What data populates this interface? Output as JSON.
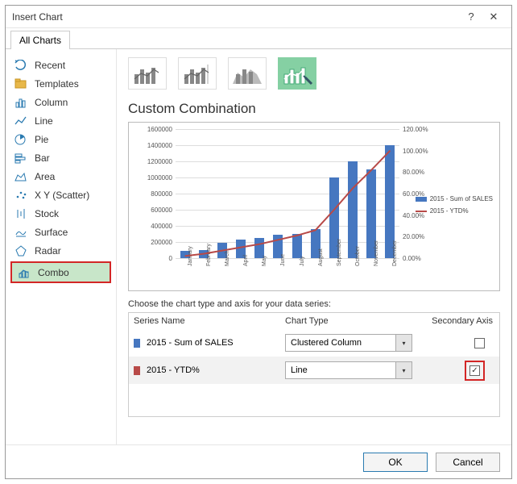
{
  "dialog": {
    "title": "Insert Chart"
  },
  "tabs": {
    "all_charts": "All Charts"
  },
  "sidebar": {
    "items": [
      {
        "label": "Recent"
      },
      {
        "label": "Templates"
      },
      {
        "label": "Column"
      },
      {
        "label": "Line"
      },
      {
        "label": "Pie"
      },
      {
        "label": "Bar"
      },
      {
        "label": "Area"
      },
      {
        "label": "X Y (Scatter)"
      },
      {
        "label": "Stock"
      },
      {
        "label": "Surface"
      },
      {
        "label": "Radar"
      },
      {
        "label": "Combo"
      }
    ]
  },
  "section": {
    "title": "Custom Combination"
  },
  "series_caption": "Choose the chart type and axis for your data series:",
  "series_table": {
    "headers": {
      "name": "Series Name",
      "type": "Chart Type",
      "axis": "Secondary Axis"
    },
    "rows": [
      {
        "color": "#4677c0",
        "name": "2015 - Sum of SALES",
        "type": "Clustered Column",
        "secondary": false
      },
      {
        "color": "#b84a48",
        "name": "2015 - YTD%",
        "type": "Line",
        "secondary": true
      }
    ]
  },
  "legend": {
    "s1": "2015 - Sum of SALES",
    "s2": "2015 - YTD%"
  },
  "buttons": {
    "ok": "OK",
    "cancel": "Cancel"
  },
  "chart_data": {
    "type": "combo",
    "title": "",
    "categories": [
      "January",
      "February",
      "March",
      "April",
      "May",
      "June",
      "July",
      "August",
      "September",
      "October",
      "November",
      "December"
    ],
    "y1": {
      "label": "",
      "min": 0,
      "max": 1600000,
      "ticks": [
        0,
        200000,
        400000,
        600000,
        800000,
        1000000,
        1200000,
        1400000,
        1600000
      ]
    },
    "y2": {
      "label": "",
      "min": 0,
      "max": 120,
      "ticks": [
        "0.00%",
        "20.00%",
        "40.00%",
        "60.00%",
        "80.00%",
        "100.00%",
        "120.00%"
      ]
    },
    "series": [
      {
        "name": "2015 - Sum of SALES",
        "type": "bar",
        "axis": "y1",
        "color": "#4677c0",
        "values": [
          90000,
          100000,
          190000,
          230000,
          250000,
          290000,
          300000,
          360000,
          1000000,
          1200000,
          1100000,
          1400000
        ]
      },
      {
        "name": "2015 - YTD%",
        "type": "line",
        "axis": "y2",
        "color": "#b84a48",
        "values": [
          2,
          4,
          7,
          10,
          13,
          17,
          21,
          26,
          45,
          65,
          82,
          100
        ]
      }
    ]
  }
}
